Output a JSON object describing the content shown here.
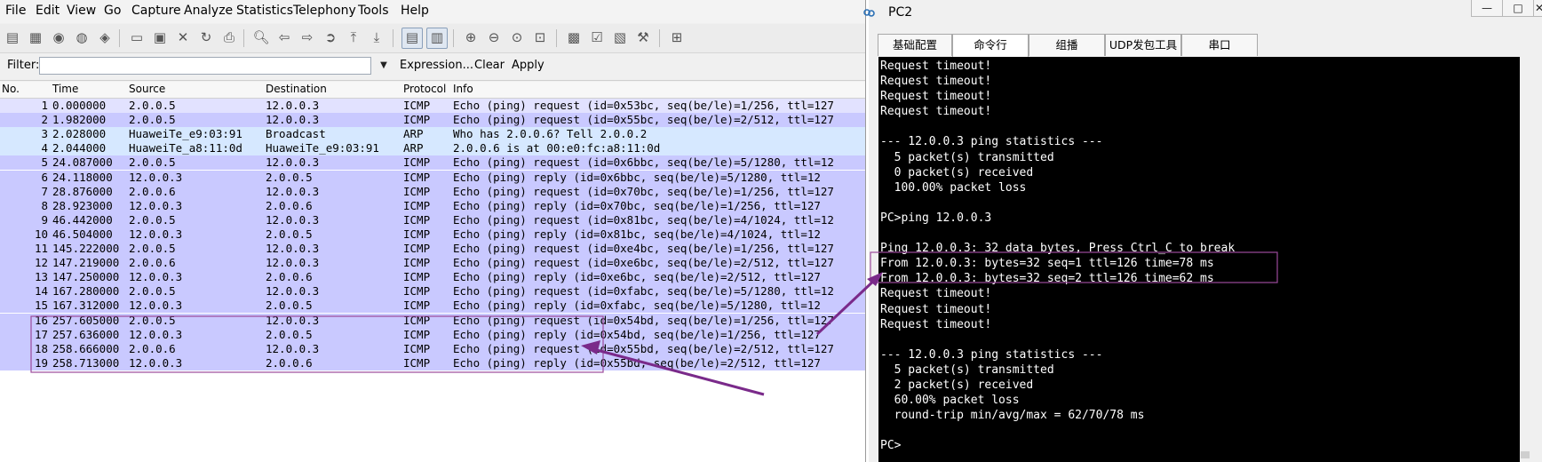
{
  "wireshark": {
    "menu": [
      "File",
      "Edit",
      "View",
      "Go",
      "Capture",
      "Analyze",
      "Statistics",
      "Telephony",
      "Tools",
      "Help"
    ],
    "filter": {
      "label": "Filter:",
      "value": "",
      "expression_label": "Expression...",
      "clear_label": "Clear",
      "apply_label": "Apply"
    },
    "columns": [
      "No.",
      "Time",
      "Source",
      "Destination",
      "Protocol",
      "Info"
    ],
    "row_colors": {
      "icmp": "#c9c9ff",
      "icmp_alt": "#ccccff",
      "arp": "#d6e8ff",
      "highlight_box": "#9b4a9b"
    },
    "rows": [
      {
        "no": "1",
        "time": "0.000000",
        "src": "2.0.0.5",
        "dst": "12.0.0.3",
        "proto": "ICMP",
        "info": "Echo (ping) request  (id=0x53bc, seq(be/le)=1/256, ttl=127",
        "kind": "icmp_light"
      },
      {
        "no": "2",
        "time": "1.982000",
        "src": "2.0.0.5",
        "dst": "12.0.0.3",
        "proto": "ICMP",
        "info": "Echo (ping) request  (id=0x55bc, seq(be/le)=2/512, ttl=127",
        "kind": "icmp"
      },
      {
        "no": "3",
        "time": "2.028000",
        "src": "HuaweiTe_e9:03:91",
        "dst": "Broadcast",
        "proto": "ARP",
        "info": "Who has 2.0.0.6?  Tell 2.0.0.2",
        "kind": "arp"
      },
      {
        "no": "4",
        "time": "2.044000",
        "src": "HuaweiTe_a8:11:0d",
        "dst": "HuaweiTe_e9:03:91",
        "proto": "ARP",
        "info": "2.0.0.6 is at 00:e0:fc:a8:11:0d",
        "kind": "arp"
      },
      {
        "no": "5",
        "time": "24.087000",
        "src": "2.0.0.5",
        "dst": "12.0.0.3",
        "proto": "ICMP",
        "info": "Echo (ping) request  (id=0x6bbc, seq(be/le)=5/1280, ttl=12",
        "kind": "icmp"
      },
      {
        "no": "6",
        "time": "24.118000",
        "src": "12.0.0.3",
        "dst": "2.0.0.5",
        "proto": "ICMP",
        "info": "Echo (ping) reply    (id=0x6bbc, seq(be/le)=5/1280, ttl=12",
        "kind": "icmp"
      },
      {
        "no": "7",
        "time": "28.876000",
        "src": "2.0.0.6",
        "dst": "12.0.0.3",
        "proto": "ICMP",
        "info": "Echo (ping) request  (id=0x70bc, seq(be/le)=1/256, ttl=127",
        "kind": "icmp"
      },
      {
        "no": "8",
        "time": "28.923000",
        "src": "12.0.0.3",
        "dst": "2.0.0.6",
        "proto": "ICMP",
        "info": "Echo (ping) reply    (id=0x70bc, seq(be/le)=1/256, ttl=127",
        "kind": "icmp"
      },
      {
        "no": "9",
        "time": "46.442000",
        "src": "2.0.0.5",
        "dst": "12.0.0.3",
        "proto": "ICMP",
        "info": "Echo (ping) request  (id=0x81bc, seq(be/le)=4/1024, ttl=12",
        "kind": "icmp"
      },
      {
        "no": "10",
        "time": "46.504000",
        "src": "12.0.0.3",
        "dst": "2.0.0.5",
        "proto": "ICMP",
        "info": "Echo (ping) reply    (id=0x81bc, seq(be/le)=4/1024, ttl=12",
        "kind": "icmp"
      },
      {
        "no": "11",
        "time": "145.222000",
        "src": "2.0.0.5",
        "dst": "12.0.0.3",
        "proto": "ICMP",
        "info": "Echo (ping) request  (id=0xe4bc, seq(be/le)=1/256, ttl=127",
        "kind": "icmp"
      },
      {
        "no": "12",
        "time": "147.219000",
        "src": "2.0.0.6",
        "dst": "12.0.0.3",
        "proto": "ICMP",
        "info": "Echo (ping) request  (id=0xe6bc, seq(be/le)=2/512, ttl=127",
        "kind": "icmp"
      },
      {
        "no": "13",
        "time": "147.250000",
        "src": "12.0.0.3",
        "dst": "2.0.0.6",
        "proto": "ICMP",
        "info": "Echo (ping) reply    (id=0xe6bc, seq(be/le)=2/512, ttl=127",
        "kind": "icmp"
      },
      {
        "no": "14",
        "time": "167.280000",
        "src": "2.0.0.5",
        "dst": "12.0.0.3",
        "proto": "ICMP",
        "info": "Echo (ping) request  (id=0xfabc, seq(be/le)=5/1280, ttl=12",
        "kind": "icmp"
      },
      {
        "no": "15",
        "time": "167.312000",
        "src": "12.0.0.3",
        "dst": "2.0.0.5",
        "proto": "ICMP",
        "info": "Echo (ping) reply    (id=0xfabc, seq(be/le)=5/1280, ttl=12",
        "kind": "icmp"
      },
      {
        "no": "16",
        "time": "257.605000",
        "src": "2.0.0.5",
        "dst": "12.0.0.3",
        "proto": "ICMP",
        "info": "Echo (ping) request  (id=0x54bd, seq(be/le)=1/256, ttl=127",
        "kind": "icmp"
      },
      {
        "no": "17",
        "time": "257.636000",
        "src": "12.0.0.3",
        "dst": "2.0.0.5",
        "proto": "ICMP",
        "info": "Echo (ping) reply    (id=0x54bd, seq(be/le)=1/256, ttl=127",
        "kind": "icmp"
      },
      {
        "no": "18",
        "time": "258.666000",
        "src": "2.0.0.6",
        "dst": "12.0.0.3",
        "proto": "ICMP",
        "info": "Echo (ping) request  (id=0x55bd, seq(be/le)=2/512, ttl=127",
        "kind": "icmp"
      },
      {
        "no": "19",
        "time": "258.713000",
        "src": "12.0.0.3",
        "dst": "2.0.0.6",
        "proto": "ICMP",
        "info": "Echo (ping) reply    (id=0x55bd, seq(be/le)=2/512, ttl=127",
        "kind": "icmp"
      }
    ]
  },
  "pc": {
    "title": "PC2",
    "tabs": [
      "基础配置",
      "命令行",
      "组播",
      "UDP发包工具",
      "串口"
    ],
    "active_tab": "命令行",
    "terminal_lines": [
      "Request timeout!",
      "Request timeout!",
      "Request timeout!",
      "Request timeout!",
      "",
      "--- 12.0.0.3 ping statistics ---",
      "  5 packet(s) transmitted",
      "  0 packet(s) received",
      "  100.00% packet loss",
      "",
      "PC>ping 12.0.0.3",
      "",
      "Ping 12.0.0.3: 32 data bytes, Press Ctrl_C to break",
      "From 12.0.0.3: bytes=32 seq=1 ttl=126 time=78 ms",
      "From 12.0.0.3: bytes=32 seq=2 ttl=126 time=62 ms",
      "Request timeout!",
      "Request timeout!",
      "Request timeout!",
      "",
      "--- 12.0.0.3 ping statistics ---",
      "  5 packet(s) transmitted",
      "  2 packet(s) received",
      "  60.00% packet loss",
      "  round-trip min/avg/max = 62/70/78 ms",
      "",
      "PC>"
    ]
  }
}
